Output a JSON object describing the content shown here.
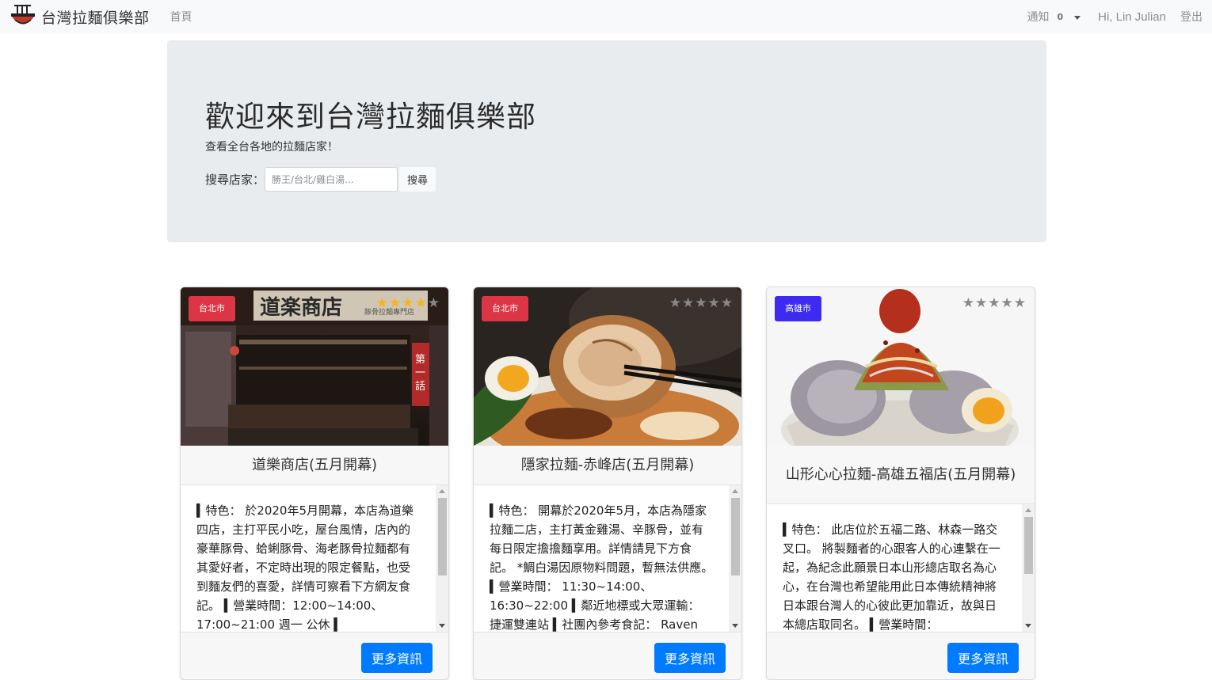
{
  "navbar": {
    "brand": "台灣拉麵俱樂部",
    "home": "首頁",
    "notify_label": "通知",
    "notify_count": "0",
    "user": "Hi, Lin Julian",
    "logout": "登出"
  },
  "hero": {
    "title": "歡迎來到台灣拉麵俱樂部",
    "subtitle": "查看全台各地的拉麵店家！",
    "search_label": "搜尋店家：",
    "search_placeholder": "勝王/台北/雞白湯...",
    "search_button": "搜尋"
  },
  "cards": [
    {
      "city": "台北市",
      "city_color": "#dc3545",
      "rating": 4,
      "title": "道樂商店(五月開幕)",
      "desc": [
        "▍特色： 於2020年5月開幕，本店為道樂四店，主打平民小吃，屋台風情，店內的豪華豚骨、蛤蜊豚骨、海老豚骨拉麵都有其愛好者，不定時出現的限定餐點，也受到麵友們的喜愛，詳情可察看下方網友食記。 ▍營業時間：12:00~14:00、17:00~21:00 週一 公休 ▍"
      ],
      "button": "更多資訊"
    },
    {
      "city": "台北市",
      "city_color": "#dc3545",
      "rating": 0,
      "title": "隱家拉麵-赤峰店(五月開幕)",
      "desc": [
        "▍特色： 開幕於2020年5月，本店為隱家拉麵二店，主打黃金雞湯、辛豚骨，並有每日限定擔擔麵享用。詳情請見下方食記。 *鯛白湯因原物料問題，暫無法供應。 ▍營業時間： 11:30~14:00、16:30~22:00 ▍鄰近地標或大眾運輸： 捷運雙連站 ▍社團內參考食記： Raven"
      ],
      "button": "更多資訊"
    },
    {
      "city": "高雄市",
      "city_color": "#3d2bf0",
      "rating": 0,
      "title": "山形心心拉麵-高雄五福店(五月開幕)",
      "desc": [
        "▍特色： 此店位於五福二路、林森一路交叉口。 將製麵者的心跟客人的心連繫在一起，為紀念此願景日本山形總店取名為心心，在台灣也希望能用此日本傳統精神將日本跟台灣人的心彼此更加靠近，故與日本總店取同名。 ▍營業時間："
      ],
      "button": "更多資訊"
    }
  ]
}
